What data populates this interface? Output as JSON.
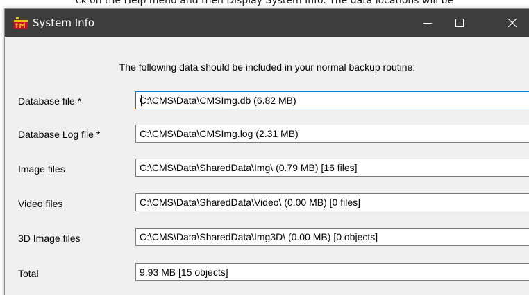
{
  "document": {
    "partial_text": "ck on the Help menu and then Display System Info. The data locations will be"
  },
  "window": {
    "title": "System Info",
    "controls": {
      "minimize": "minimize",
      "maximize": "maximize",
      "close": "close"
    }
  },
  "content": {
    "heading": "The following data should be included in your normal backup routine:",
    "fields": [
      {
        "label": "Database file  *",
        "value": "C:\\CMS\\Data\\CMSImg.db (6.82 MB)"
      },
      {
        "label": "Database Log file  *",
        "value": "C:\\CMS\\Data\\CMSImg.log (2.31 MB)"
      },
      {
        "label": "Image files",
        "value": "C:\\CMS\\Data\\SharedData\\Img\\ (0.79 MB) [16 files]"
      },
      {
        "label": "Video files",
        "value": "C:\\CMS\\Data\\SharedData\\Video\\ (0.00 MB) [0 files]"
      },
      {
        "label": "3D Image files",
        "value": "C:\\CMS\\Data\\SharedData\\Img3D\\ (0.00 MB) [0 objects]"
      },
      {
        "label": "Total",
        "value": "9.93 MB [15 objects]"
      }
    ]
  },
  "colors": {
    "titlebar": "#3d3d3d",
    "focus_border": "#0078d7",
    "content_bg": "#f0f0f0"
  }
}
